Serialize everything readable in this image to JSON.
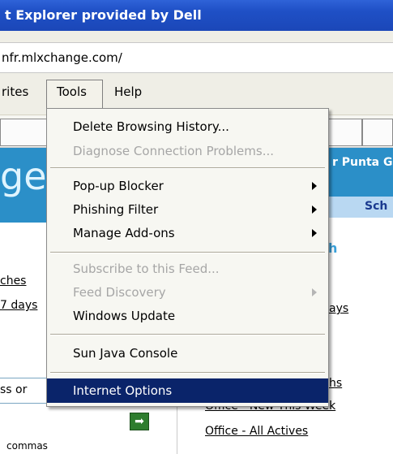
{
  "window": {
    "title": "t Explorer provided by Dell"
  },
  "address": {
    "url": "nfr.mlxchange.com/"
  },
  "menubar": {
    "items": [
      "rites",
      "Tools",
      "Help"
    ]
  },
  "tools_menu": {
    "items": [
      {
        "label": "Delete Browsing History...",
        "enabled": true,
        "submenu": false
      },
      {
        "label": "Diagnose Connection Problems...",
        "enabled": false,
        "submenu": false
      },
      {
        "label": "Pop-up Blocker",
        "enabled": true,
        "submenu": true
      },
      {
        "label": "Phishing Filter",
        "enabled": true,
        "submenu": true
      },
      {
        "label": "Manage Add-ons",
        "enabled": true,
        "submenu": true
      },
      {
        "label": "Subscribe to this Feed...",
        "enabled": false,
        "submenu": false
      },
      {
        "label": "Feed Discovery",
        "enabled": false,
        "submenu": true
      },
      {
        "label": "Windows Update",
        "enabled": true,
        "submenu": false
      },
      {
        "label": "Sun Java Console",
        "enabled": true,
        "submenu": false
      },
      {
        "label": "Internet Options",
        "enabled": true,
        "submenu": false,
        "highlighted": true
      }
    ]
  },
  "page": {
    "left_banner": "ge",
    "right_banner": "r Punta G",
    "right_schedule": "Sch",
    "right_heading": "h",
    "left_links": [
      "ches",
      "7 days"
    ],
    "left_text": "ss or",
    "right_links": [
      "ays",
      "hs",
      "Office - New This Week",
      "Office - All Actives"
    ],
    "bottom_text": "commas",
    "go_symbol": "➡"
  },
  "colors": {
    "titlebar": "#1f50c6",
    "menu_highlight": "#0a246a",
    "banner": "#2b8fc8",
    "disabled_text": "#a6a6a6"
  }
}
